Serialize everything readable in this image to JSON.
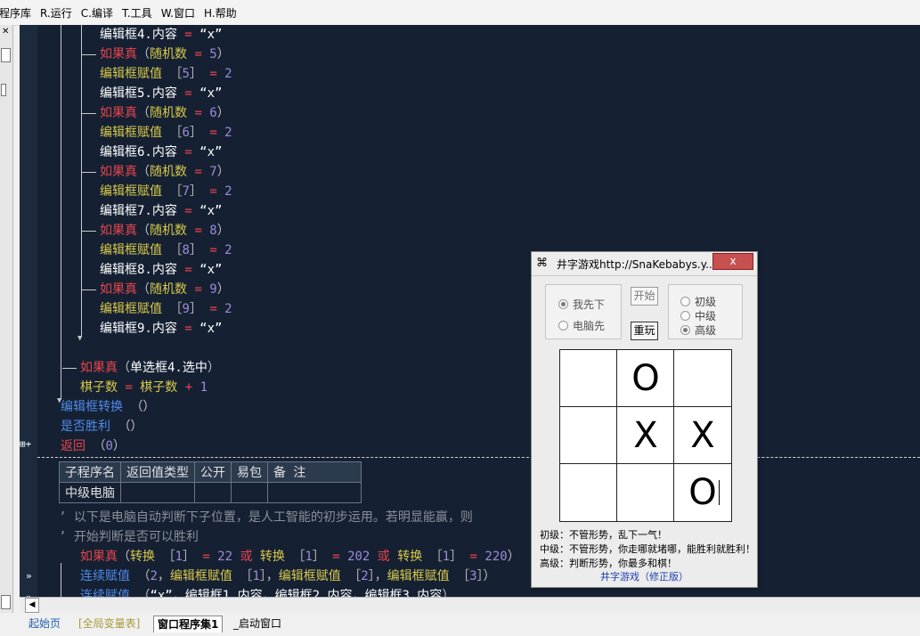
{
  "menu": [
    "程序库",
    "R.运行",
    "C.编译",
    "T.工具",
    "W.窗口",
    "H.帮助"
  ],
  "code_lines": [
    [
      {
        "t": "编辑框4.内容 ",
        "c": "w"
      },
      {
        "t": "= ",
        "c": "r"
      },
      {
        "t": "“x”",
        "c": "w"
      }
    ],
    [
      {
        "t": "如果真",
        "c": "r"
      },
      {
        "t": "（",
        "c": "g"
      },
      {
        "t": "随机数 ",
        "c": "y"
      },
      {
        "t": "= ",
        "c": "r"
      },
      {
        "t": "5",
        "c": "p"
      },
      {
        "t": "）",
        "c": "g"
      }
    ],
    [
      {
        "t": "编辑框赋值 ",
        "c": "y"
      },
      {
        "t": "［",
        "c": "g"
      },
      {
        "t": "5",
        "c": "p"
      },
      {
        "t": "］ ",
        "c": "g"
      },
      {
        "t": "= ",
        "c": "r"
      },
      {
        "t": "2",
        "c": "p"
      }
    ],
    [
      {
        "t": "编辑框5.内容 ",
        "c": "w"
      },
      {
        "t": "= ",
        "c": "r"
      },
      {
        "t": "“x”",
        "c": "w"
      }
    ],
    [
      {
        "t": "如果真",
        "c": "r"
      },
      {
        "t": "（",
        "c": "g"
      },
      {
        "t": "随机数 ",
        "c": "y"
      },
      {
        "t": "= ",
        "c": "r"
      },
      {
        "t": "6",
        "c": "p"
      },
      {
        "t": "）",
        "c": "g"
      }
    ],
    [
      {
        "t": "编辑框赋值 ",
        "c": "y"
      },
      {
        "t": "［",
        "c": "g"
      },
      {
        "t": "6",
        "c": "p"
      },
      {
        "t": "］ ",
        "c": "g"
      },
      {
        "t": "= ",
        "c": "r"
      },
      {
        "t": "2",
        "c": "p"
      }
    ],
    [
      {
        "t": "编辑框6.内容 ",
        "c": "w"
      },
      {
        "t": "= ",
        "c": "r"
      },
      {
        "t": "“x”",
        "c": "w"
      }
    ],
    [
      {
        "t": "如果真",
        "c": "r"
      },
      {
        "t": "（",
        "c": "g"
      },
      {
        "t": "随机数 ",
        "c": "y"
      },
      {
        "t": "= ",
        "c": "r"
      },
      {
        "t": "7",
        "c": "p"
      },
      {
        "t": "）",
        "c": "g"
      }
    ],
    [
      {
        "t": "编辑框赋值 ",
        "c": "y"
      },
      {
        "t": "［",
        "c": "g"
      },
      {
        "t": "7",
        "c": "p"
      },
      {
        "t": "］ ",
        "c": "g"
      },
      {
        "t": "= ",
        "c": "r"
      },
      {
        "t": "2",
        "c": "p"
      }
    ],
    [
      {
        "t": "编辑框7.内容 ",
        "c": "w"
      },
      {
        "t": "= ",
        "c": "r"
      },
      {
        "t": "“x”",
        "c": "w"
      }
    ],
    [
      {
        "t": "如果真",
        "c": "r"
      },
      {
        "t": "（",
        "c": "g"
      },
      {
        "t": "随机数 ",
        "c": "y"
      },
      {
        "t": "= ",
        "c": "r"
      },
      {
        "t": "8",
        "c": "p"
      },
      {
        "t": "）",
        "c": "g"
      }
    ],
    [
      {
        "t": "编辑框赋值 ",
        "c": "y"
      },
      {
        "t": "［",
        "c": "g"
      },
      {
        "t": "8",
        "c": "p"
      },
      {
        "t": "］ ",
        "c": "g"
      },
      {
        "t": "= ",
        "c": "r"
      },
      {
        "t": "2",
        "c": "p"
      }
    ],
    [
      {
        "t": "编辑框8.内容 ",
        "c": "w"
      },
      {
        "t": "= ",
        "c": "r"
      },
      {
        "t": "“x”",
        "c": "w"
      }
    ],
    [
      {
        "t": "如果真",
        "c": "r"
      },
      {
        "t": "（",
        "c": "g"
      },
      {
        "t": "随机数 ",
        "c": "y"
      },
      {
        "t": "= ",
        "c": "r"
      },
      {
        "t": "9",
        "c": "p"
      },
      {
        "t": "）",
        "c": "g"
      }
    ],
    [
      {
        "t": "编辑框赋值 ",
        "c": "y"
      },
      {
        "t": "［",
        "c": "g"
      },
      {
        "t": "9",
        "c": "p"
      },
      {
        "t": "］ ",
        "c": "g"
      },
      {
        "t": "= ",
        "c": "r"
      },
      {
        "t": "2",
        "c": "p"
      }
    ],
    [
      {
        "t": "编辑框9.内容 ",
        "c": "w"
      },
      {
        "t": "= ",
        "c": "r"
      },
      {
        "t": "“x”",
        "c": "w"
      }
    ],
    [],
    [
      {
        "t": "如果真",
        "c": "r"
      },
      {
        "t": "（",
        "c": "g"
      },
      {
        "t": "单选框4.选中",
        "c": "w"
      },
      {
        "t": "）",
        "c": "g"
      }
    ],
    [
      {
        "t": "棋子数 ",
        "c": "y"
      },
      {
        "t": "= ",
        "c": "r"
      },
      {
        "t": "棋子数 ",
        "c": "y"
      },
      {
        "t": "+ ",
        "c": "r"
      },
      {
        "t": "1",
        "c": "p"
      }
    ],
    [
      {
        "t": "编辑框转换 ",
        "c": "b"
      },
      {
        "t": "（）",
        "c": "g"
      }
    ],
    [
      {
        "t": "是否胜利 ",
        "c": "b"
      },
      {
        "t": "（）",
        "c": "g"
      }
    ],
    [
      {
        "t": "返回 ",
        "c": "r"
      },
      {
        "t": "（",
        "c": "g"
      },
      {
        "t": "0",
        "c": "p"
      },
      {
        "t": "）",
        "c": "g"
      }
    ]
  ],
  "subroutine_table": {
    "headers": [
      "子程序名",
      "返回值类型",
      "公开",
      "易包",
      "备 注"
    ],
    "row": [
      "中级电脑",
      "",
      "",
      "",
      ""
    ]
  },
  "lower_lines": [
    [
      {
        "t": "’ 以下是电脑自动判断下子位置，是人工智能的初步运用。若明显能赢，则",
        "c": "c"
      }
    ],
    [
      {
        "t": "’ 开始判断是否可以胜利",
        "c": "c"
      }
    ],
    [
      {
        "t": "如果真",
        "c": "r"
      },
      {
        "t": "（",
        "c": "g"
      },
      {
        "t": "转换 ",
        "c": "y"
      },
      {
        "t": "［",
        "c": "g"
      },
      {
        "t": "1",
        "c": "p"
      },
      {
        "t": "］ ",
        "c": "g"
      },
      {
        "t": "= ",
        "c": "r"
      },
      {
        "t": "22 ",
        "c": "p"
      },
      {
        "t": "或 ",
        "c": "r"
      },
      {
        "t": "转换 ",
        "c": "y"
      },
      {
        "t": "［",
        "c": "g"
      },
      {
        "t": "1",
        "c": "p"
      },
      {
        "t": "］ ",
        "c": "g"
      },
      {
        "t": "= ",
        "c": "r"
      },
      {
        "t": "202 ",
        "c": "p"
      },
      {
        "t": "或 ",
        "c": "r"
      },
      {
        "t": "转换 ",
        "c": "y"
      },
      {
        "t": "［",
        "c": "g"
      },
      {
        "t": "1",
        "c": "p"
      },
      {
        "t": "］ ",
        "c": "g"
      },
      {
        "t": "= ",
        "c": "r"
      },
      {
        "t": "220",
        "c": "p"
      },
      {
        "t": "）",
        "c": "g"
      }
    ],
    [
      {
        "t": "连续赋值 ",
        "c": "b"
      },
      {
        "t": "（",
        "c": "g"
      },
      {
        "t": "2",
        "c": "p"
      },
      {
        "t": "，",
        "c": "g"
      },
      {
        "t": "编辑框赋值 ",
        "c": "y"
      },
      {
        "t": "［",
        "c": "g"
      },
      {
        "t": "1",
        "c": "p"
      },
      {
        "t": "］",
        "c": "g"
      },
      {
        "t": "，",
        "c": "g"
      },
      {
        "t": "编辑框赋值 ",
        "c": "y"
      },
      {
        "t": "［",
        "c": "g"
      },
      {
        "t": "2",
        "c": "p"
      },
      {
        "t": "］",
        "c": "g"
      },
      {
        "t": "，",
        "c": "g"
      },
      {
        "t": "编辑框赋值 ",
        "c": "y"
      },
      {
        "t": "［",
        "c": "g"
      },
      {
        "t": "3",
        "c": "p"
      },
      {
        "t": "］",
        "c": "g"
      },
      {
        "t": "）",
        "c": "g"
      }
    ],
    [
      {
        "t": "连续赋值 ",
        "c": "b"
      },
      {
        "t": "（",
        "c": "g"
      },
      {
        "t": "“x”",
        "c": "w"
      },
      {
        "t": "，",
        "c": "g"
      },
      {
        "t": "编辑框1.内容",
        "c": "w"
      },
      {
        "t": "，",
        "c": "g"
      },
      {
        "t": "编辑框2.内容",
        "c": "w"
      },
      {
        "t": "，",
        "c": "g"
      },
      {
        "t": "编辑框3.内容",
        "c": "w"
      },
      {
        "t": "）",
        "c": "g"
      }
    ]
  ],
  "tabs": [
    "起始页",
    "[全局变量表]",
    "窗口程序集1",
    "_启动窗口"
  ],
  "dialog": {
    "title": "井字游戏http://SnaKebabys.y...",
    "close_label": "x",
    "radio_first": [
      {
        "label": "我先下",
        "checked": true
      },
      {
        "label": "电脑先",
        "checked": false
      }
    ],
    "start_button": "开始",
    "restart_button": "重玩",
    "levels": [
      {
        "label": "初级",
        "checked": false
      },
      {
        "label": "中级",
        "checked": false
      },
      {
        "label": "高级",
        "checked": true
      }
    ],
    "board": [
      "",
      "O",
      "",
      "",
      "X",
      "X",
      "",
      "",
      "O"
    ],
    "hints": [
      "初级：不管形势，乱下一气！",
      "中级：不管形势，你走哪就堵哪，能胜利就胜利！",
      "高级：判断形势，你最多和棋！"
    ],
    "footer": "井字游戏（修正版）"
  }
}
